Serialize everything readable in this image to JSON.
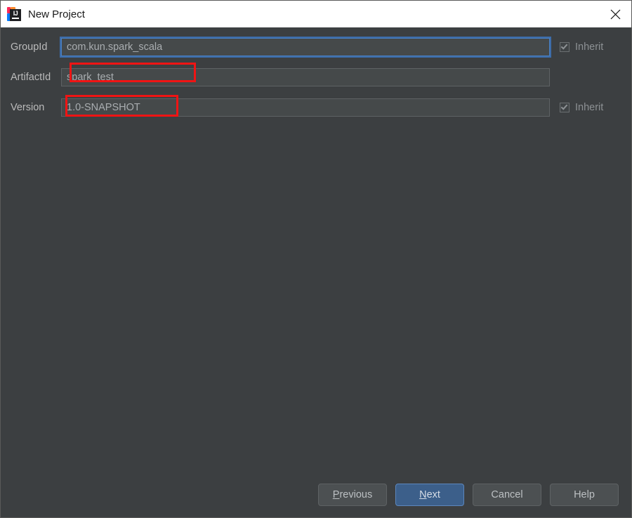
{
  "window": {
    "title": "New Project",
    "app_icon": "intellij-idea-logo",
    "close_icon": "close-icon",
    "background_color": "#3c3f41",
    "titlebar_color": "#ffffff"
  },
  "form": {
    "fields": [
      {
        "id": "groupid",
        "label": "GroupId",
        "value": "com.kun.spark_scala",
        "placeholder": "",
        "focused": true,
        "inherit": {
          "label": "Inherit",
          "checked": true,
          "visible": true
        },
        "annotated": true
      },
      {
        "id": "artifactid",
        "label": "ArtifactId",
        "value": "spark_test",
        "placeholder": "",
        "focused": false,
        "inherit": {
          "label": "",
          "checked": false,
          "visible": false
        },
        "annotated": true
      },
      {
        "id": "version",
        "label": "Version",
        "value": "1.0-SNAPSHOT",
        "placeholder": "",
        "focused": false,
        "inherit": {
          "label": "Inherit",
          "checked": true,
          "visible": true
        },
        "annotated": false
      }
    ]
  },
  "buttons": {
    "previous": {
      "label": "Previous",
      "mnemonic": "P",
      "default": false
    },
    "next": {
      "label": "Next",
      "mnemonic": "N",
      "default": true
    },
    "cancel": {
      "label": "Cancel",
      "mnemonic": "",
      "default": false
    },
    "help": {
      "label": "Help",
      "mnemonic": "",
      "default": false
    }
  },
  "colors": {
    "accent_focus": "#4a81c4",
    "default_button": "#3c5f8a",
    "annotation": "#f01414",
    "field_background": "#45494a",
    "text": "#bbbbbb"
  },
  "annotations": [
    {
      "name": "groupid-highlight",
      "color": "#f01414"
    },
    {
      "name": "artifactid-highlight",
      "color": "#f01414"
    }
  ]
}
